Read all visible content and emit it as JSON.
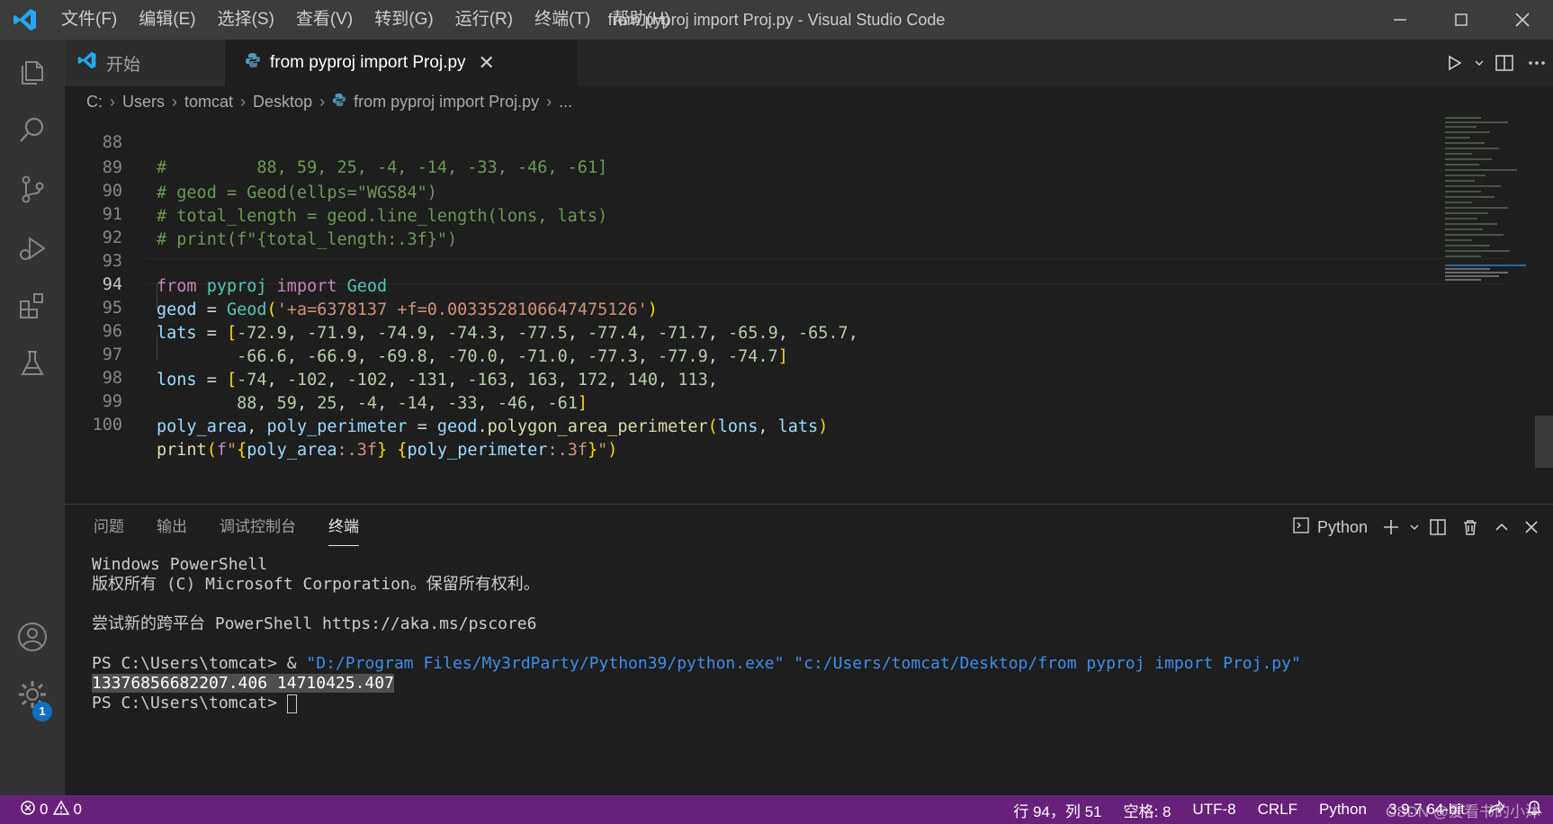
{
  "window": {
    "title": "from pyproj import Proj.py - Visual Studio Code",
    "menu": [
      "文件(F)",
      "编辑(E)",
      "选择(S)",
      "查看(V)",
      "转到(G)",
      "运行(R)",
      "终端(T)",
      "帮助(H)"
    ]
  },
  "tabs": {
    "start_label": "开始",
    "file_label": "from pyproj import Proj.py"
  },
  "breadcrumb": [
    "C:",
    "Users",
    "tomcat",
    "Desktop",
    "from pyproj import Proj.py",
    "..."
  ],
  "editor": {
    "current_line": 94,
    "lines": [
      {
        "n": "88",
        "text": "#         88, 59, 25, -4, -14, -33, -46, -61]"
      },
      {
        "n": "89",
        "text": "# geod = Geod(ellps=\"WGS84\")"
      },
      {
        "n": "90",
        "text": "# total_length = geod.line_length(lons, lats)"
      },
      {
        "n": "91",
        "text": "# print(f\"{total_length:.3f}\")"
      },
      {
        "n": "92",
        "text": ""
      },
      {
        "n": "93",
        "text": "from pyproj import Geod"
      },
      {
        "n": "94",
        "text": "geod = Geod('+a=6378137 +f=0.0033528106647475126')"
      },
      {
        "n": "95",
        "text": "lats = [-72.9, -71.9, -74.9, -74.3, -77.5, -77.4, -71.7, -65.9, -65.7,"
      },
      {
        "n": "96",
        "text": "        -66.6, -66.9, -69.8, -70.0, -71.0, -77.3, -77.9, -74.7]"
      },
      {
        "n": "97",
        "text": "lons = [-74, -102, -102, -131, -163, 163, 172, 140, 113,"
      },
      {
        "n": "98",
        "text": "        88, 59, 25, -4, -14, -33, -46, -61]"
      },
      {
        "n": "99",
        "text": "poly_area, poly_perimeter = geod.polygon_area_perimeter(lons, lats)"
      },
      {
        "n": "100",
        "text": "print(f\"{poly_area:.3f} {poly_perimeter:.3f}\")"
      }
    ]
  },
  "panel": {
    "tabs": [
      "问题",
      "输出",
      "调试控制台",
      "终端"
    ],
    "active_tab": "终端",
    "shell_label": "Python",
    "terminal": {
      "line1": "Windows PowerShell",
      "line2": "版权所有 (C) Microsoft Corporation。保留所有权利。",
      "line3": "尝试新的跨平台 PowerShell https://aka.ms/pscore6",
      "prompt1": "PS C:\\Users\\tomcat> & ",
      "exe": "\"D:/Program Files/My3rdParty/Python39/python.exe\"",
      "script": "\"c:/Users/tomcat/Desktop/from pyproj import Proj.py\"",
      "output": "13376856682207.406 14710425.407",
      "prompt2": "PS C:\\Users\\tomcat> "
    }
  },
  "status": {
    "errors": "0",
    "warnings": "0",
    "position": "行 94，列 51",
    "spaces": "空格: 8",
    "encoding": "UTF-8",
    "eol": "CRLF",
    "language": "Python",
    "interpreter": "3.9.7 64-bit",
    "watermark": "CSDN @爱看书的小沐"
  },
  "activity": {
    "settings_badge": "1"
  },
  "colors": {
    "statusbar": "#68217a",
    "accent": "#0e70c0"
  }
}
